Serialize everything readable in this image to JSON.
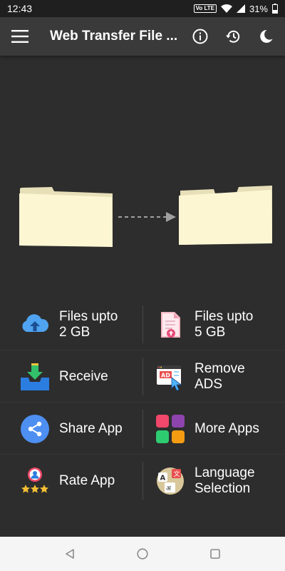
{
  "status_bar": {
    "time": "12:43",
    "network_badge": "Vo LTE",
    "battery": "31%",
    "icons": [
      "volte-icon",
      "wifi-icon",
      "signal-icon",
      "battery-icon"
    ]
  },
  "app_bar": {
    "title": "Web Transfer File ...",
    "icons": [
      "menu-icon",
      "info-icon",
      "history-icon",
      "dark-mode-icon"
    ]
  },
  "illustration": {
    "icons": [
      "folder-icon",
      "dashed-arrow-icon",
      "folder-icon"
    ],
    "colors": {
      "folder": "#fdf6d3",
      "folder_back": "#e7dfb8",
      "arrow": "#a0a0a0"
    }
  },
  "features": [
    {
      "left": {
        "label": "Files upto\n2 GB",
        "icon": "cloud-upload-icon"
      },
      "right": {
        "label": "Files upto\n5 GB",
        "icon": "file-upload-icon"
      }
    },
    {
      "left": {
        "label": "Receive",
        "icon": "download-tray-icon"
      },
      "right": {
        "label": "Remove\nADS",
        "icon": "remove-ads-icon"
      }
    },
    {
      "left": {
        "label": "Share App",
        "icon": "share-icon"
      },
      "right": {
        "label": "More Apps",
        "icon": "more-apps-icon"
      }
    },
    {
      "left": {
        "label": "Rate App",
        "icon": "rate-star-icon"
      },
      "right": {
        "label": "Language\nSelection",
        "icon": "language-icon"
      }
    }
  ],
  "nav_bar": {
    "icons": [
      "back-icon",
      "home-icon",
      "recents-icon"
    ]
  },
  "colors": {
    "background": "#2d2d2d",
    "app_bar": "#3a3a3a",
    "nav_bar": "#f5f5f5"
  }
}
